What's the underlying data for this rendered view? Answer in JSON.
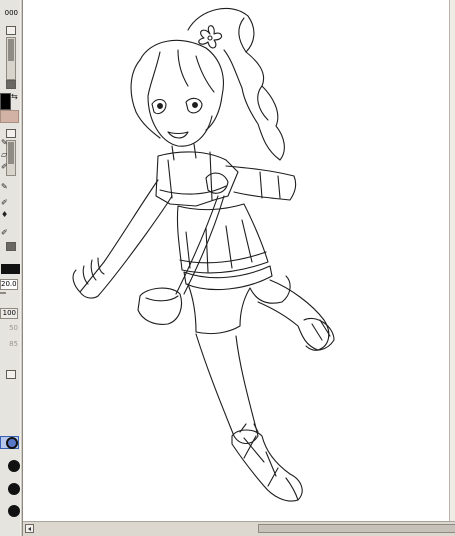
{
  "tool_panel": {
    "brush_size_top": "000",
    "brush_size": "20.0",
    "density": "100",
    "value_a": "50",
    "value_b": "85"
  },
  "colors": {
    "foreground": "#000000",
    "secondary": "#d2b2a4",
    "canvas": "#ffffff",
    "line": "#1e1e1e"
  },
  "icons": [
    "swap-colors-icon",
    "pen-icon",
    "eraser-icon",
    "brush-icon",
    "water-icon",
    "scroll-left-icon"
  ],
  "canvas_content": "line-art"
}
